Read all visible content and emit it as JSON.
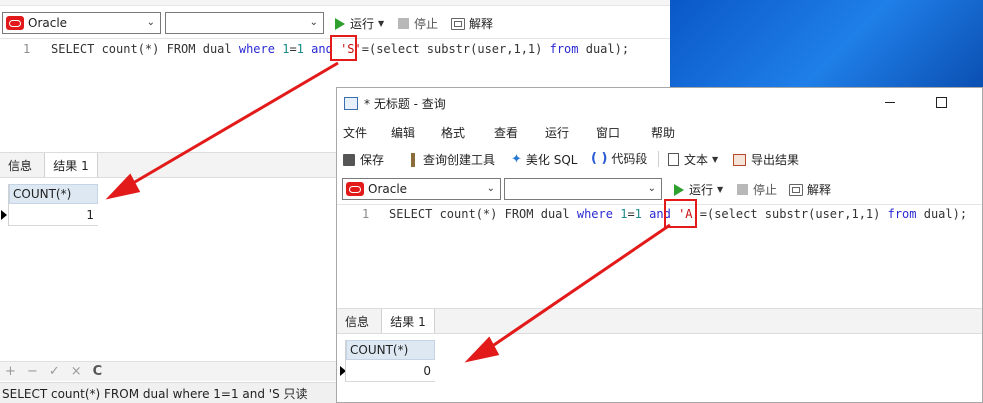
{
  "window1": {
    "connection": "Oracle",
    "database": "",
    "run_label": "运行",
    "stop_label": "停止",
    "explain_label": "解释",
    "line_number": "1",
    "sql": {
      "p1": "SELECT count(*) FROM dual ",
      "where": "where",
      "p2": " ",
      "n1a": "1",
      "eq": "=",
      "n1b": "1",
      "p3": " ",
      "and": "and",
      "p4": " ",
      "str": "'S'",
      "p5": "=(select substr(user,1,1) ",
      "from": "from",
      "p6": " dual);"
    },
    "tabs": [
      "信息",
      "结果 1"
    ],
    "result": {
      "column": "COUNT(*)",
      "value": "1"
    },
    "grid_tools": [
      "+",
      "−",
      "✓",
      "×",
      "C"
    ],
    "status": "SELECT count(*) FROM dual where 1=1 and 'S 只读"
  },
  "window2": {
    "title": "* 无标题 - 查询",
    "menu": [
      "文件",
      "编辑",
      "格式",
      "查看",
      "运行",
      "窗口",
      "帮助"
    ],
    "toolbar": {
      "save": "保存",
      "query_builder": "查询创建工具",
      "beautify": "美化 SQL",
      "code_snippet": "代码段",
      "text": "文本",
      "export": "导出结果"
    },
    "connection": "Oracle",
    "database": "",
    "run_label": "运行",
    "stop_label": "停止",
    "explain_label": "解释",
    "line_number": "1",
    "sql": {
      "p1": "SELECT count(*) FROM dual ",
      "where": "where",
      "p2": " ",
      "n1a": "1",
      "eq": "=",
      "n1b": "1",
      "p3": " ",
      "and": "and",
      "p4": " ",
      "str": "'A'",
      "p5": "=(select substr(user,1,1) ",
      "from": "from",
      "p6": " dual);"
    },
    "tabs": [
      "信息",
      "结果 1"
    ],
    "result": {
      "column": "COUNT(*)",
      "value": "0"
    }
  },
  "colors": {
    "accent_red": "#e21a1a",
    "keyword": "#2a2ad2",
    "number": "#1a8a8a",
    "header": "#dde8f3"
  }
}
